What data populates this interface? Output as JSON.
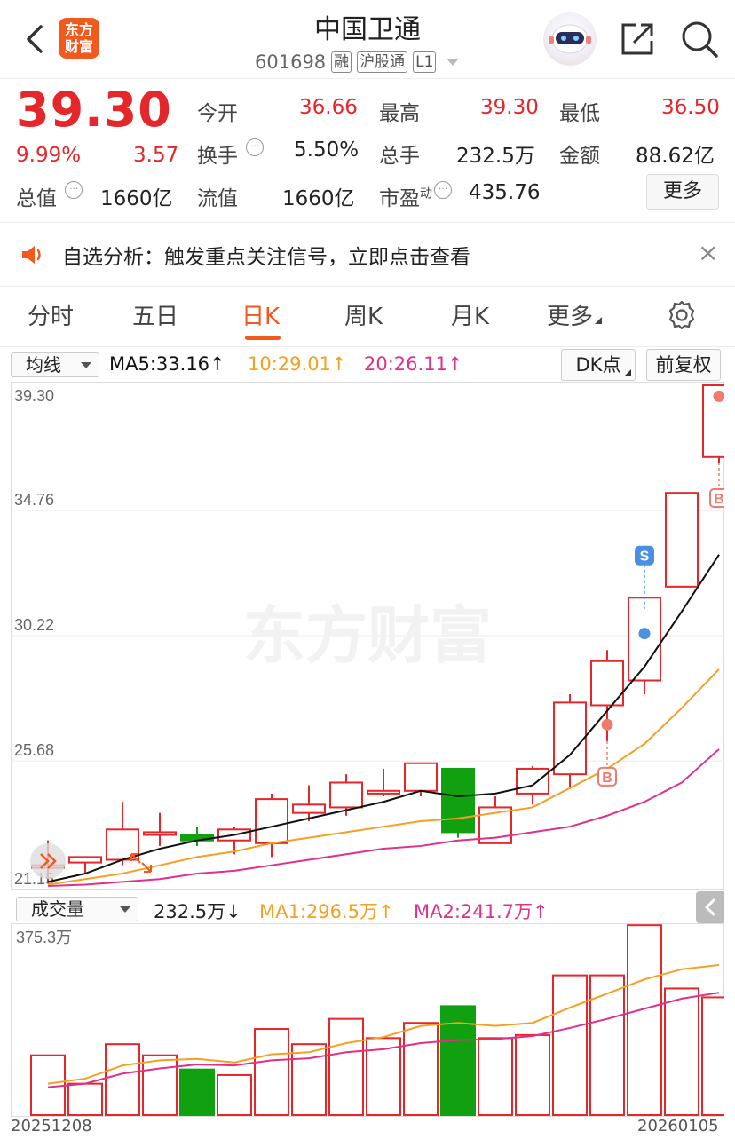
{
  "header": {
    "title": "中国卫通",
    "logo_text": "东方财富",
    "code": "601698",
    "tags": [
      "融",
      "沪股通",
      "L1"
    ]
  },
  "quote": {
    "price": "39.30",
    "change_pct": "9.99%",
    "change": "3.57",
    "row1": [
      {
        "label": "今开",
        "value": "36.66"
      },
      {
        "label": "最高",
        "value": "39.30"
      },
      {
        "label": "最低",
        "value": "36.50"
      }
    ],
    "row2": [
      {
        "label": "换手",
        "value": "5.50%"
      },
      {
        "label": "总手",
        "value": "232.5万"
      },
      {
        "label": "金额",
        "value": "88.62亿"
      }
    ],
    "row3": [
      {
        "label": "总值",
        "value": "1660亿"
      },
      {
        "label": "流值",
        "value": "1660亿"
      },
      {
        "label": "市盈",
        "sup": "动",
        "value": "435.76"
      }
    ],
    "more_label": "更多"
  },
  "alert": {
    "text": "自选分析：触发重点关注信号，立即点击查看",
    "close": "×"
  },
  "tabs": [
    "分时",
    "五日",
    "日K",
    "周K",
    "月K",
    "更多"
  ],
  "active_tab": "日K",
  "indicator_bar": {
    "select": "均线",
    "ma5": "MA5:33.16↑",
    "ma10": "10:29.01↑",
    "ma20": "20:26.11↑",
    "dk_button": "DK点",
    "adjust_button": "前复权"
  },
  "colors": {
    "up": "#e5262b",
    "down": "#10a010",
    "ma5": "#111111",
    "ma10": "#f5a023",
    "ma20": "#e0308a",
    "accent": "#f25a1d",
    "s_marker": "#4a90e2",
    "b_marker": "#f07a6e"
  },
  "watermark": "东方财富",
  "volume_bar": {
    "select": "成交量",
    "value": "232.5万↓",
    "ma1": "MA1:296.5万↑",
    "ma2": "MA2:241.7万↑",
    "max_label": "375.3万"
  },
  "dates": {
    "start": "20251208",
    "end": "20260105"
  },
  "chart_data": {
    "type": "candlestick",
    "y_ticks": [
      "39.30",
      "34.76",
      "30.22",
      "25.68",
      "21.15"
    ],
    "ylim": [
      21.15,
      39.3
    ],
    "candles": [
      {
        "o": 21.9,
        "h": 22.8,
        "l": 21.3,
        "c": 21.9
      },
      {
        "o": 22.0,
        "h": 22.2,
        "l": 21.6,
        "c": 22.2
      },
      {
        "o": 22.1,
        "h": 24.2,
        "l": 21.9,
        "c": 23.2
      },
      {
        "o": 23.0,
        "h": 23.8,
        "l": 22.6,
        "c": 23.1
      },
      {
        "o": 23.0,
        "h": 23.3,
        "l": 22.6,
        "c": 22.8
      },
      {
        "o": 22.8,
        "h": 23.3,
        "l": 22.3,
        "c": 23.2
      },
      {
        "o": 22.7,
        "h": 24.5,
        "l": 22.2,
        "c": 24.3
      },
      {
        "o": 23.8,
        "h": 24.8,
        "l": 23.5,
        "c": 24.1
      },
      {
        "o": 24.0,
        "h": 25.2,
        "l": 23.7,
        "c": 24.9
      },
      {
        "o": 24.5,
        "h": 25.4,
        "l": 24.4,
        "c": 24.6
      },
      {
        "o": 24.6,
        "h": 25.6,
        "l": 24.4,
        "c": 25.6
      },
      {
        "o": 25.4,
        "h": 25.4,
        "l": 22.9,
        "c": 23.1
      },
      {
        "o": 22.7,
        "h": 24.4,
        "l": 22.7,
        "c": 24.0
      },
      {
        "o": 24.5,
        "h": 25.5,
        "l": 24.1,
        "c": 25.4
      },
      {
        "o": 25.2,
        "h": 28.1,
        "l": 24.7,
        "c": 27.8
      },
      {
        "o": 27.7,
        "h": 29.7,
        "l": 26.4,
        "c": 29.3
      },
      {
        "o": 28.6,
        "h": 31.2,
        "l": 28.1,
        "c": 31.6
      },
      {
        "o": 32.0,
        "h": 32.0,
        "l": 32.0,
        "c": 35.4
      },
      {
        "o": 36.7,
        "h": 39.3,
        "l": 36.5,
        "c": 39.3
      }
    ],
    "ma5": [
      21.3,
      21.6,
      22.1,
      22.5,
      22.8,
      23.0,
      23.3,
      23.6,
      23.9,
      24.2,
      24.6,
      24.4,
      24.5,
      24.8,
      25.9,
      27.5,
      29.1,
      31.1,
      33.16
    ],
    "ma10": [
      21.2,
      21.4,
      21.6,
      21.9,
      22.2,
      22.4,
      22.7,
      22.9,
      23.1,
      23.3,
      23.5,
      23.6,
      23.8,
      24.0,
      24.7,
      25.4,
      26.3,
      27.6,
      29.01
    ],
    "ma20": [
      21.15,
      21.2,
      21.3,
      21.4,
      21.6,
      21.7,
      21.9,
      22.1,
      22.3,
      22.5,
      22.6,
      22.8,
      22.9,
      23.1,
      23.3,
      23.7,
      24.2,
      24.9,
      26.11
    ],
    "markers": [
      {
        "index": 15,
        "type": "B",
        "price": 27.0
      },
      {
        "index": 16,
        "type": "S",
        "price": 30.3
      },
      {
        "index": 18,
        "type": "B",
        "price": 38.9
      }
    ],
    "volume": {
      "ylim": [
        0,
        375.3
      ],
      "unit": "万",
      "values": [
        118,
        62,
        140,
        118,
        90,
        79,
        170,
        140,
        190,
        152,
        182,
        215,
        152,
        158,
        276,
        276,
        375,
        250,
        232.5
      ],
      "ma1": [
        62,
        72,
        98,
        108,
        111,
        104,
        120,
        124,
        142,
        154,
        176,
        182,
        176,
        182,
        212,
        240,
        268,
        288,
        296.5
      ],
      "ma2": [
        55,
        62,
        82,
        92,
        100,
        98,
        108,
        112,
        124,
        130,
        142,
        148,
        150,
        156,
        172,
        190,
        210,
        230,
        241.7
      ]
    }
  }
}
